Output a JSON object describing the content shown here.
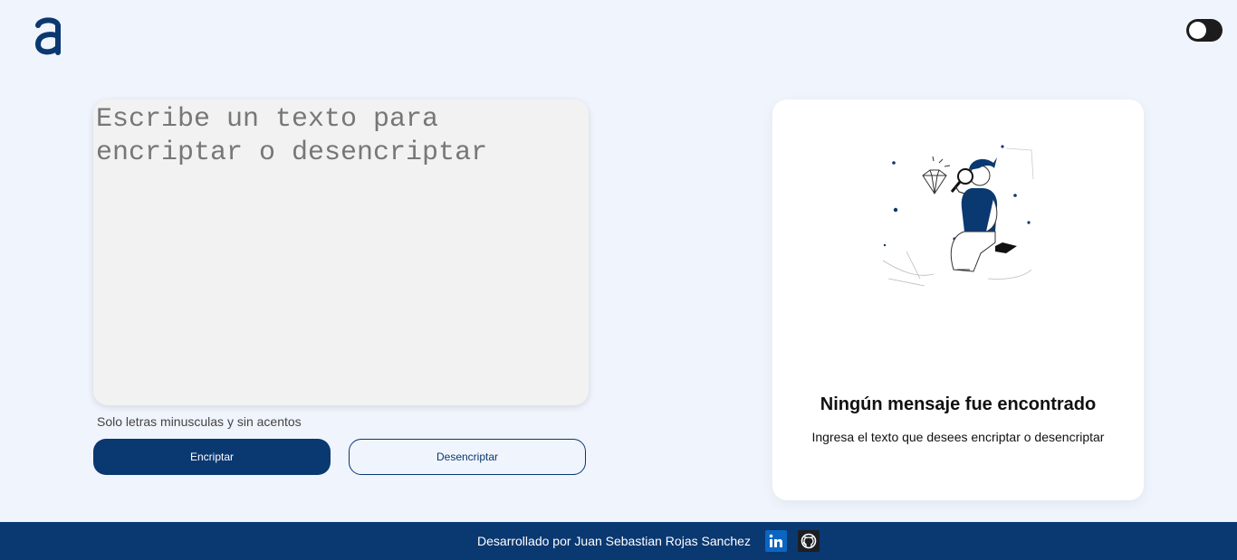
{
  "header": {
    "logo_icon": "alura-a-logo-icon",
    "theme_toggle_icon": "dark-mode-toggle-icon"
  },
  "input": {
    "placeholder": "Escribe un texto para encriptar o desencriptar",
    "value": ""
  },
  "hint": "Solo letras minusculas y sin acentos",
  "buttons": {
    "encrypt_label": "Encriptar",
    "decrypt_label": "Desencriptar"
  },
  "output": {
    "illustration_icon": "person-with-magnifier-illustration",
    "title": "Ningún mensaje fue encontrado",
    "subtitle": "Ingresa el texto que desees encriptar o desencriptar"
  },
  "footer": {
    "text": "Desarrollado por Juan Sebastian Rojas Sanchez",
    "linkedin_icon": "linkedin-icon",
    "github_icon": "github-icon"
  },
  "colors": {
    "primary": "#0a3871",
    "background": "#f0f4fc",
    "card": "#ffffff",
    "textarea": "#f2f2f2"
  }
}
